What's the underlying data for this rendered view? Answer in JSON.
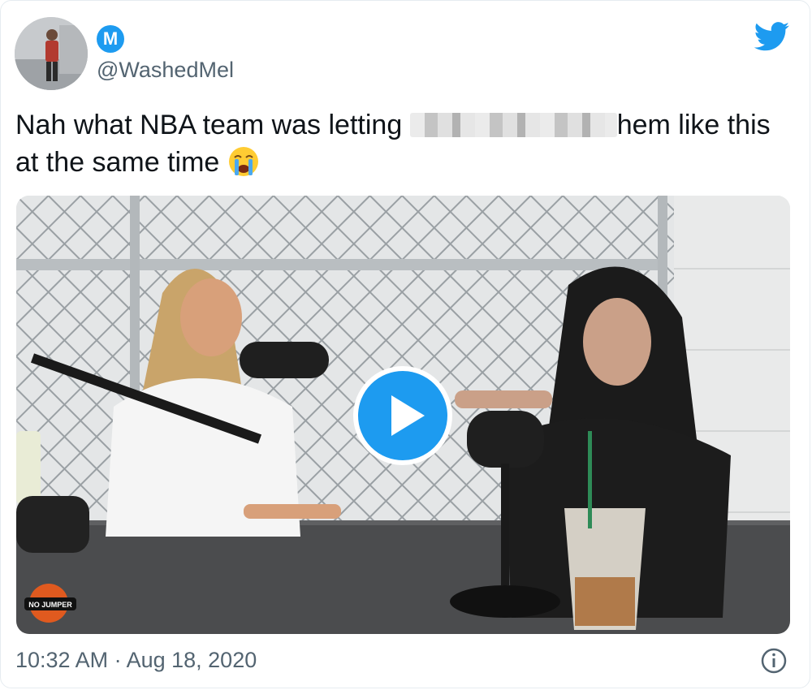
{
  "tweet": {
    "verified_badge_letter": "M",
    "handle": "@WashedMel",
    "text_before_redaction": "Nah what NBA team was letting ",
    "text_after_redaction": "hem like this at the same time ",
    "emoji": "crying-face-emoji",
    "timestamp": "10:32 AM · Aug 18, 2020"
  },
  "media": {
    "watermark": "NO JUMPER",
    "type": "video"
  },
  "icons": {
    "brand": "twitter-bird-icon",
    "play": "play-icon",
    "info": "info-icon"
  },
  "colors": {
    "twitter_blue": "#1d9bf0",
    "handle_gray": "#536471",
    "text": "#0f1419"
  }
}
